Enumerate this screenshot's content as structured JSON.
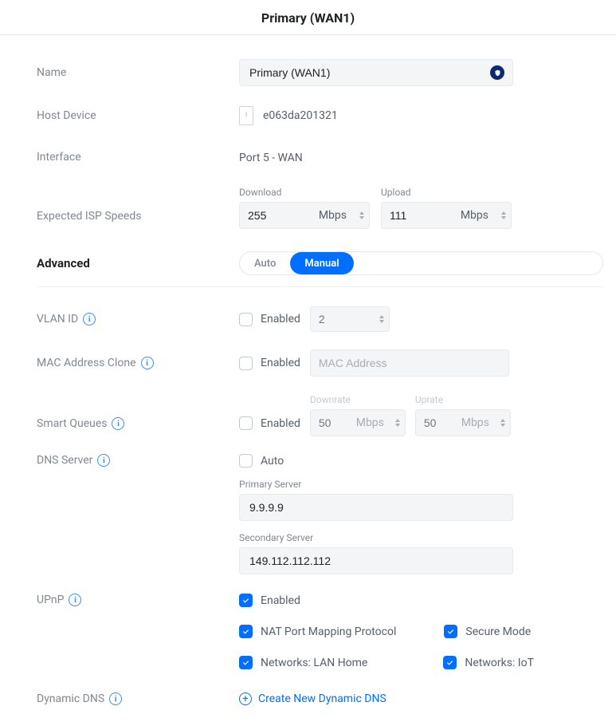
{
  "title": "Primary (WAN1)",
  "labels": {
    "name": "Name",
    "host_device": "Host Device",
    "interface": "Interface",
    "expected_isp": "Expected ISP Speeds",
    "advanced": "Advanced",
    "vlan_id": "VLAN ID",
    "mac_clone": "MAC Address Clone",
    "smart_queues": "Smart Queues",
    "dns_server": "DNS Server",
    "upnp": "UPnP",
    "dynamic_dns": "Dynamic DNS"
  },
  "name_value": "Primary (WAN1)",
  "host_device_value": "e063da201321",
  "interface_value": "Port 5 - WAN",
  "speeds": {
    "download_label": "Download",
    "upload_label": "Upload",
    "download": "255",
    "upload": "111",
    "unit": "Mbps"
  },
  "advanced_mode": {
    "auto_label": "Auto",
    "manual_label": "Manual",
    "active": "manual"
  },
  "enabled_text": "Enabled",
  "auto_text": "Auto",
  "vlan": {
    "enabled": false,
    "placeholder": "2"
  },
  "mac_clone": {
    "enabled": false,
    "placeholder": "MAC Address"
  },
  "smart_queues": {
    "enabled": false,
    "downrate_label": "Downrate",
    "uprate_label": "Uprate",
    "downrate": "50",
    "uprate": "50",
    "unit": "Mbps"
  },
  "dns": {
    "auto": false,
    "primary_label": "Primary Server",
    "secondary_label": "Secondary Server",
    "primary": "9.9.9.9",
    "secondary": "149.112.112.112"
  },
  "upnp": {
    "enabled": true,
    "nat_pmp_label": "NAT Port Mapping Protocol",
    "nat_pmp": true,
    "secure_mode_label": "Secure Mode",
    "secure_mode": true,
    "net_lan_label": "Networks: LAN Home",
    "net_lan": true,
    "net_iot_label": "Networks: IoT",
    "net_iot": true
  },
  "dynamic_dns_link": "Create New Dynamic DNS"
}
